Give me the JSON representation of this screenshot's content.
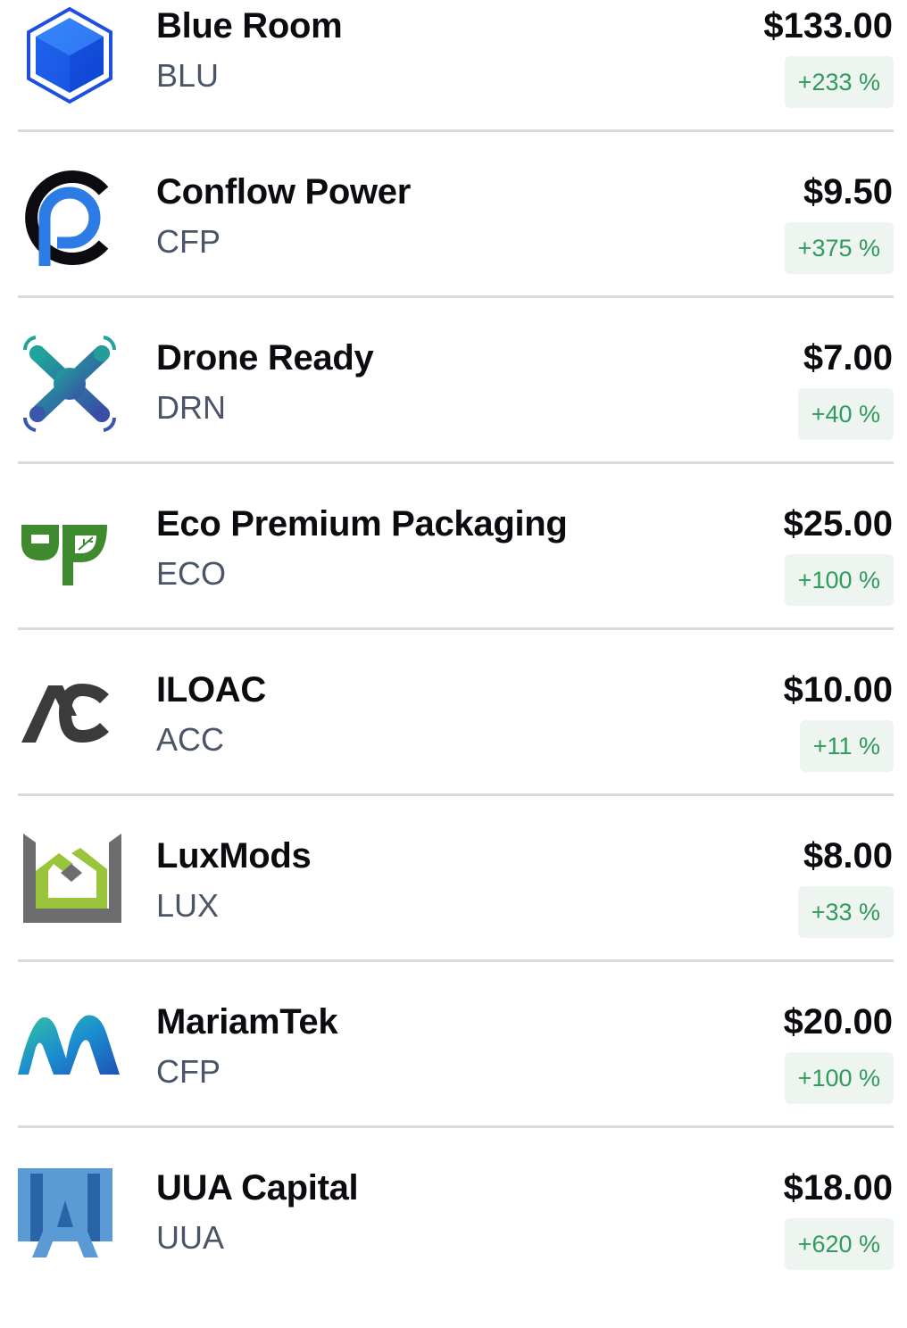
{
  "assets": [
    {
      "name": "Blue Room",
      "ticker": "BLU",
      "price": "$133.00",
      "change": "+233 %",
      "logo_icon": "blue-cube-icon"
    },
    {
      "name": "Conflow Power",
      "ticker": "CFP",
      "price": "$9.50",
      "change": "+375 %",
      "logo_icon": "conflow-power-logo-icon"
    },
    {
      "name": "Drone Ready",
      "ticker": "DRN",
      "price": "$7.00",
      "change": "+40 %",
      "logo_icon": "drone-logo-icon"
    },
    {
      "name": "Eco Premium Packaging",
      "ticker": "ECO",
      "price": "$25.00",
      "change": "+100 %",
      "logo_icon": "eco-leaf-logo-icon"
    },
    {
      "name": "ILOAC",
      "ticker": "ACC",
      "price": "$10.00",
      "change": "+11 %",
      "logo_icon": "ac-monogram-logo-icon"
    },
    {
      "name": "LuxMods",
      "ticker": "LUX",
      "price": "$8.00",
      "change": "+33 %",
      "logo_icon": "luxmods-house-logo-icon"
    },
    {
      "name": "MariamTek",
      "ticker": "CFP",
      "price": "$20.00",
      "change": "+100 %",
      "logo_icon": "mariamtek-m-logo-icon"
    },
    {
      "name": "UUA Capital",
      "ticker": "UUA",
      "price": "$18.00",
      "change": "+620 %",
      "logo_icon": "uua-capital-logo-icon"
    }
  ],
  "colors": {
    "positive_change_text": "#2e9c5a",
    "positive_change_bg": "#eef4f0",
    "divider": "#d9dadd",
    "ticker_text": "#4a5568"
  }
}
